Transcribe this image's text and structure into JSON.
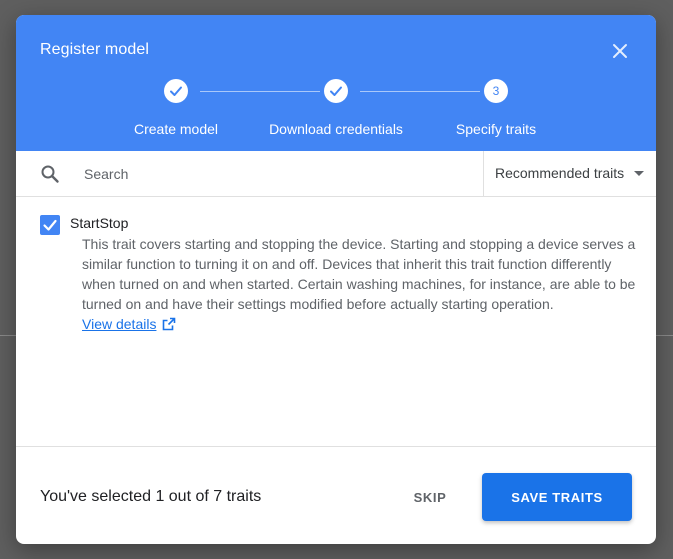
{
  "dialog": {
    "title": "Register model",
    "close_icon": "close-icon"
  },
  "stepper": {
    "steps": [
      {
        "label": "Create model",
        "state": "completed",
        "icon": "check-icon"
      },
      {
        "label": "Download credentials",
        "state": "completed",
        "icon": "check-icon"
      },
      {
        "label": "Specify traits",
        "state": "active",
        "number": "3"
      }
    ]
  },
  "search": {
    "placeholder": "Search",
    "value": "",
    "icon": "search-icon"
  },
  "filter": {
    "selected": "Recommended traits",
    "icon": "chevron-down-icon"
  },
  "traits": [
    {
      "name": "StartStop",
      "checked": true,
      "description": "This trait covers starting and stopping the device. Starting and stopping a device serves a similar function to turning it on and off. Devices that inherit this trait function differently when turned on and when started. Certain washing machines, for instance, are able to be turned on and have their settings modified before actually starting operation.",
      "link_label": "View details",
      "link_icon": "external-link-icon"
    }
  ],
  "footer": {
    "selected_text": "You've selected 1 out of 7 traits",
    "skip_label": "SKIP",
    "save_label": "SAVE TRAITS"
  },
  "colors": {
    "header": "#4285f4",
    "primary_button": "#1a73e8",
    "link": "#1a73e8",
    "backdrop": "#5f5f5f"
  }
}
